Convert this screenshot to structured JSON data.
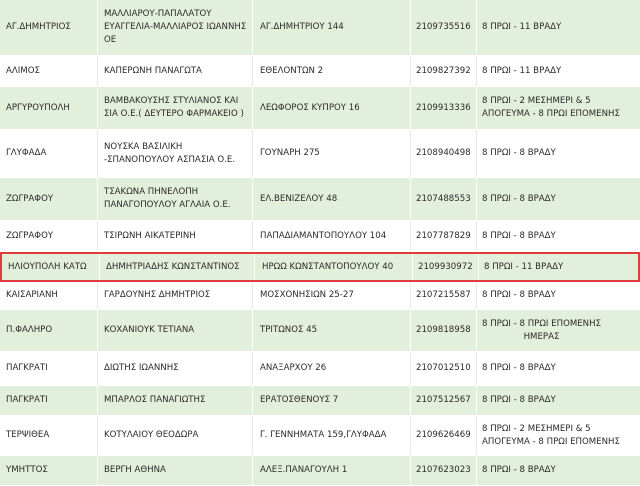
{
  "pharmacies": [
    {
      "area": "ΑΓ.ΔΗΜΗΤΡΙΟΣ",
      "name": [
        "ΜΑΛΛΙΑΡΟΥ-ΠΑΠΑΛΑΤΟΥ",
        "ΕΥΑΓΓΕΛΙΑ-ΜΑΛΛΙΑΡΟΣ ΙΩΑΝΝΗΣ",
        "ΟΕ"
      ],
      "address": "ΑΓ.ΔΗΜΗΤΡΙΟΥ 144",
      "phone": "2109735516",
      "hours": [
        "8 ΠΡΩΙ - 11 ΒΡΑΔΥ"
      ]
    },
    {
      "area": "ΑΛΙΜΟΣ",
      "name": [
        "ΚΑΠΕΡΩΝΗ ΠΑΝΑΓΩΤΑ"
      ],
      "address": "ΕΘΕΛΟΝΤΩΝ 2",
      "phone": "2109827392",
      "hours": [
        "8 ΠΡΩΙ - 11 ΒΡΑΔΥ"
      ]
    },
    {
      "area": "ΑΡΓΥΡΟΥΠΟΛΗ",
      "name": [
        "ΒΑΜΒΑΚΟΥΣΗΣ ΣΤΥΛΙΑΝΟΣ ΚΑΙ",
        "ΣΙΑ Ο.Ε.( ΔΕΥΤΕΡΟ ΦΑΡΜΑΚΕΙΟ )"
      ],
      "address": "ΛΕΩΦΟΡΟΣ ΚΥΠΡΟΥ 16",
      "phone": "2109913336",
      "hours": [
        "8 ΠΡΩΙ - 2 ΜΕΣΗΜΕΡΙ & 5",
        "ΑΠΟΓΕΥΜΑ - 8 ΠΡΩΙ ΕΠΟΜΕΝΗΣ"
      ]
    },
    {
      "area": "ΓΛΥΦΑΔΑ",
      "name": [
        "ΝΟΥΣΚΑ ΒΑΣΙΛΙΚΗ",
        "-ΣΠΑΝΟΠΟΥΛΟΥ ΑΣΠΑΣΙΑ Ο.Ε."
      ],
      "address": "ΓΟΥΝΑΡΗ 275",
      "phone": "2108940498",
      "hours": [
        "8 ΠΡΩΙ - 8 ΒΡΑΔΥ"
      ]
    },
    {
      "area": "ΖΩΓΡΑΦΟΥ",
      "name": [
        "ΤΣΑΚΩΝΑ ΠΗΝΕΛΟΠΗ",
        "ΠΑΝΑΓΟΠΟΥΛΟΥ ΑΓΛΑΙΑ Ο.Ε."
      ],
      "address": "ΕΛ.ΒΕΝΙΖΕΛΟΥ 48",
      "phone": "2107488553",
      "hours": [
        "8 ΠΡΩΙ - 8 ΒΡΑΔΥ"
      ]
    },
    {
      "area": "ΖΩΓΡΑΦΟΥ",
      "name": [
        "ΤΣΙΡΩΝΗ ΑΙΚΑΤΕΡΙΝΗ"
      ],
      "address": "ΠΑΠΑΔΙΑΜΑΝΤΟΠΟΥΛΟΥ 104",
      "phone": "2107787829",
      "hours": [
        "8 ΠΡΩΙ - 8 ΒΡΑΔΥ"
      ]
    },
    {
      "area": "ΗΛΙΟΥΠΟΛΗ ΚΑΤΩ",
      "name": [
        "ΔΗΜΗΤΡΙΑΔΗΣ ΚΩΝΣΤΑΝΤΙΝΟΣ"
      ],
      "address": "ΗΡΩΩ ΚΩΝΣΤΑΝΤΟΠΟΥΛΟΥ 40",
      "phone": "2109930972",
      "hours": [
        "8 ΠΡΩΙ - 11 ΒΡΑΔΥ"
      ]
    },
    {
      "area": "ΚΑΙΣΑΡΙΑΝΗ",
      "name": [
        "ΓΑΡΔΟΥΝΗΣ ΔΗΜΗΤΡΙΟΣ"
      ],
      "address": "ΜΟΣΧΟΝΗΣΙΩΝ 25-27",
      "phone": "2107215587",
      "hours": [
        "8 ΠΡΩΙ - 8 ΒΡΑΔΥ"
      ]
    },
    {
      "area": "Π.ΦΑΛΗΡΟ",
      "name": [
        "ΚΟΧΑΝΙΟΥΚ ΤΕΤΙΑΝΑ"
      ],
      "address": "ΤΡΙΤΩΝΟΣ 45",
      "phone": "2109818958",
      "hours": [
        "8 ΠΡΩΙ - 8 ΠΡΩΙ ΕΠΟΜΕΝΗΣ",
        "ΗΜΕΡΑΣ"
      ]
    },
    {
      "area": "ΠΑΓΚΡΑΤΙ",
      "name": [
        "ΔΙΩΤΗΣ ΙΩΑΝΝΗΣ"
      ],
      "address": "ΑΝΑΞΑΡΧΟΥ 26",
      "phone": "2107012510",
      "hours": [
        "8 ΠΡΩΙ - 8 ΒΡΑΔΥ"
      ]
    },
    {
      "area": "ΠΑΓΚΡΑΤΙ",
      "name": [
        "ΜΠΑΡΛΟΣ ΠΑΝΑΓΙΩΤΗΣ"
      ],
      "address": "ΕΡΑΤΟΣΘΕΝΟΥΣ 7",
      "phone": "2107512567",
      "hours": [
        "8 ΠΡΩΙ - 8 ΒΡΑΔΥ"
      ]
    },
    {
      "area": "ΤΕΡΨΙΘΕΑ",
      "name": [
        "ΚΟΤΥΛΑΙΟΥ ΘΕΟΔΩΡΑ"
      ],
      "address": "Γ. ΓΕΝΝΗΜΑΤΑ 159,ΓΛΥΦΑΔΑ",
      "phone": "2109626469",
      "hours": [
        "8 ΠΡΩΙ - 2 ΜΕΣΗΜΕΡΙ & 5",
        "ΑΠΟΓΕΥΜΑ - 8 ΠΡΩΙ ΕΠΟΜΕΝΗΣ"
      ]
    },
    {
      "area": "ΥΜΗΤΤΟΣ",
      "name": [
        "ΒΕΡΓΗ ΑΘΗΝΑ"
      ],
      "address": "ΑΛΕΞ.ΠΑΝΑΓΟΥΛΗ 1",
      "phone": "2107623023",
      "hours": [
        "8 ΠΡΩΙ - 8 ΒΡΑΔΥ"
      ]
    }
  ],
  "highlighted_row": 6,
  "colors": {
    "row_alt": "#e2efda",
    "row_plain": "#ffffff",
    "highlight_border": "#e23b3b",
    "text": "#2a2a2a"
  }
}
